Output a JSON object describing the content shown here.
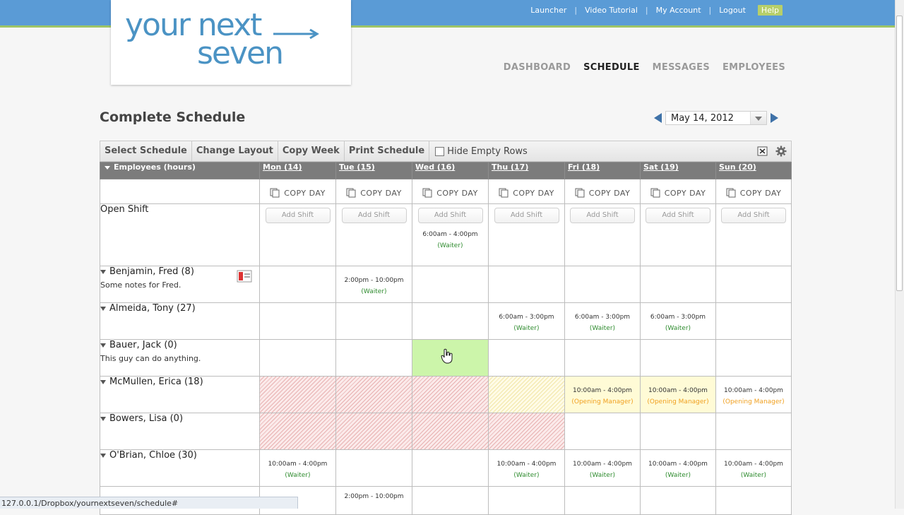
{
  "toplinks": {
    "launcher": "Launcher",
    "video": "Video Tutorial",
    "account": "My Account",
    "logout": "Logout",
    "help": "Help",
    "sep": "|"
  },
  "logo": {
    "line1": "your next",
    "line2": "seven"
  },
  "nav": {
    "dashboard": "DASHBOARD",
    "schedule": "SCHEDULE",
    "messages": "MESSAGES",
    "employees": "EMPLOYEES"
  },
  "page": {
    "title": "Complete Schedule",
    "date": "May 14, 2012"
  },
  "toolbar": {
    "select": "Select Schedule",
    "layout": "Change Layout",
    "copy": "Copy Week",
    "print": "Print Schedule",
    "hide": "Hide Empty Rows"
  },
  "header": {
    "employees": "Employees (hours)",
    "days": [
      "Mon (14)",
      "Tue (15)",
      "Wed (16)",
      "Thu (17)",
      "Fri (18)",
      "Sat (19)",
      "Sun (20)"
    ]
  },
  "copyday": "COPY DAY",
  "addshift": "Add Shift",
  "open_shift": {
    "label": "Open Shift",
    "wed_time": "6:00am - 4:00pm",
    "wed_role": "(Waiter)"
  },
  "rows": {
    "fred": {
      "name": "Benjamin, Fred (8)",
      "note": "Some notes for Fred.",
      "tue_time": "2:00pm - 10:00pm",
      "tue_role": "(Waiter)"
    },
    "tony": {
      "name": "Almeida, Tony (27)",
      "time": "6:00am - 3:00pm",
      "role": "(Waiter)"
    },
    "jack": {
      "name": "Bauer, Jack (0)",
      "note": "This guy can do anything."
    },
    "erica": {
      "name": "McMullen, Erica (18)",
      "time": "10:00am - 4:00pm",
      "role": "(Opening Manager)"
    },
    "lisa": {
      "name": "Bowers, Lisa (0)"
    },
    "chloe": {
      "name": "O'Brian, Chloe (30)",
      "time": "10:00am - 4:00pm",
      "role": "(Waiter)"
    },
    "next": {
      "tue_time": "2:00pm - 10:00pm"
    }
  },
  "status_url": "127.0.0.1/Dropbox/yournextseven/schedule#",
  "colors": {
    "topbar": "#5a9bd6",
    "accent_green": "#9cc466",
    "logo_blue": "#4b93c4",
    "header_gray": "#7c7c7c",
    "waiter_green": "#2e8b2e",
    "manager_orange": "#f0a020"
  }
}
